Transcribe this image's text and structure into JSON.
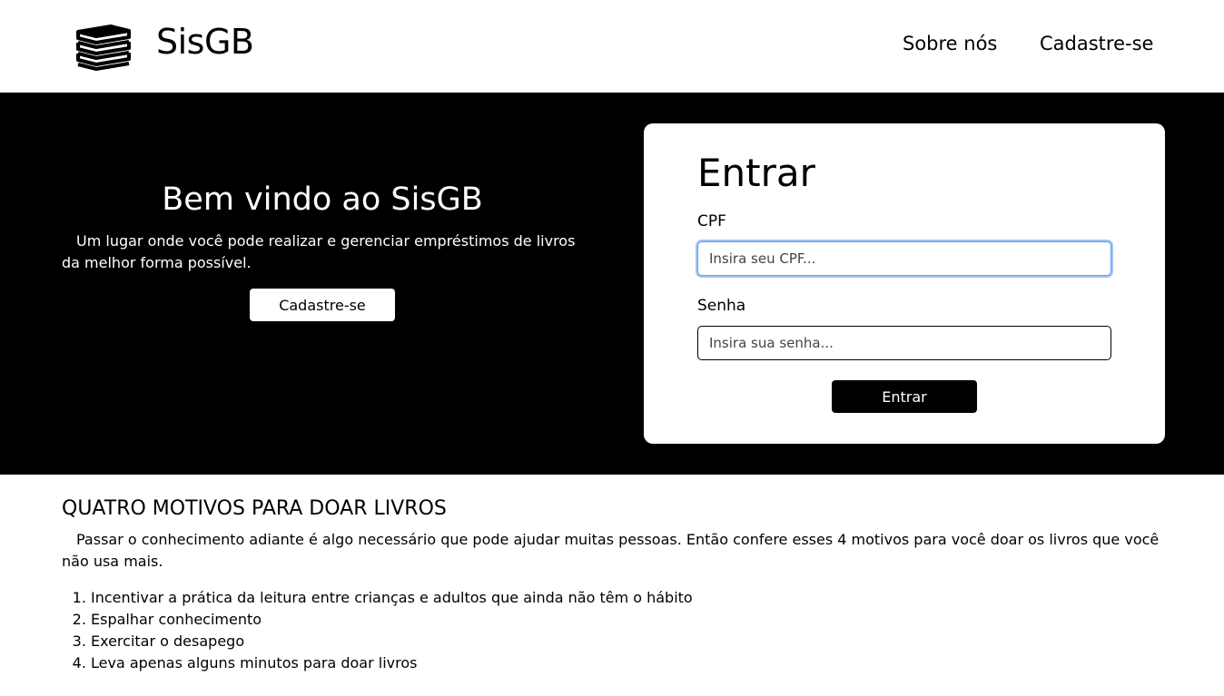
{
  "header": {
    "brand": "SisGB",
    "logo_icon": "books-stack-icon",
    "nav": {
      "about": "Sobre nós",
      "signup": "Cadastre-se"
    }
  },
  "hero": {
    "title": "Bem vindo ao SisGB",
    "text": "Um lugar onde você pode realizar e gerenciar empréstimos de livros da melhor forma possível.",
    "button": "Cadastre-se"
  },
  "login": {
    "title": "Entrar",
    "cpf_label": "CPF",
    "cpf_placeholder": "Insira seu CPF...",
    "cpf_value": "",
    "password_label": "Senha",
    "password_placeholder": "Insira sua senha...",
    "password_value": "",
    "button": "Entrar",
    "focus_color": "#9ec5f8"
  },
  "content": {
    "heading": "QUATRO MOTIVOS PARA DOAR LIVROS",
    "intro": "Passar o conhecimento adiante é algo necessário que pode ajudar muitas pessoas. Então confere esses 4 motivos para você doar os livros que você não usa mais.",
    "reasons": [
      "Incentivar a prática da leitura entre crianças e adultos que ainda não têm o hábito",
      "Espalhar conhecimento",
      "Exercitar o desapego",
      "Leva apenas alguns minutos para doar livros"
    ]
  }
}
